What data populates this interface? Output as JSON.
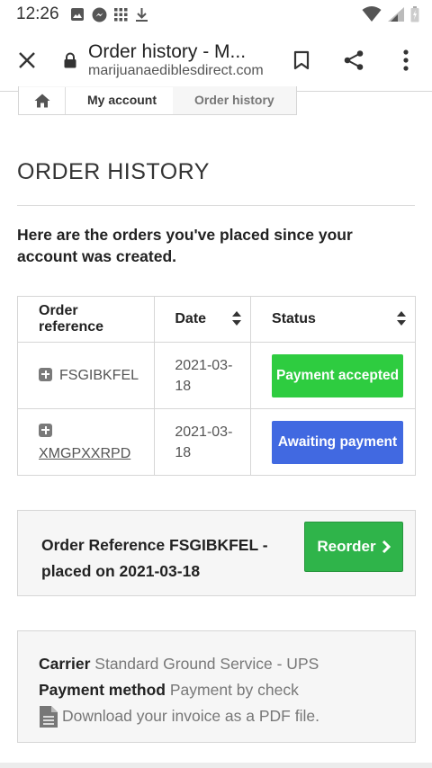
{
  "status_bar": {
    "time": "12:26"
  },
  "browser": {
    "title": "Order history - M...",
    "url": "marijuanaediblesdirect.com"
  },
  "breadcrumb": {
    "items": [
      "My account",
      "Order history"
    ]
  },
  "page": {
    "heading": "ORDER HISTORY",
    "intro": "Here are the orders you've placed since your account was created."
  },
  "table": {
    "headers": [
      "Order reference",
      "Date",
      "Status"
    ],
    "rows": [
      {
        "reference": "FSGIBKFEL",
        "date": "2021-03-18",
        "status": "Payment accepted",
        "status_color": "#2ecc40"
      },
      {
        "reference": "XMGPXXRPD",
        "date": "2021-03-18",
        "status": "Awaiting payment",
        "status_color": "#4169e1"
      }
    ]
  },
  "order_detail": {
    "text": "Order Reference FSGIBKFEL - placed on 2021-03-18",
    "reorder_label": "Reorder"
  },
  "order_info": {
    "carrier_label": "Carrier",
    "carrier_value": "Standard Ground Service - UPS",
    "payment_label": "Payment method",
    "payment_value": "Payment by check",
    "invoice_text": "Download your invoice as a PDF file."
  },
  "colors": {
    "reorder_button": "#2fb44a",
    "accent_green": "#2ecc40",
    "accent_blue": "#4169e1"
  }
}
